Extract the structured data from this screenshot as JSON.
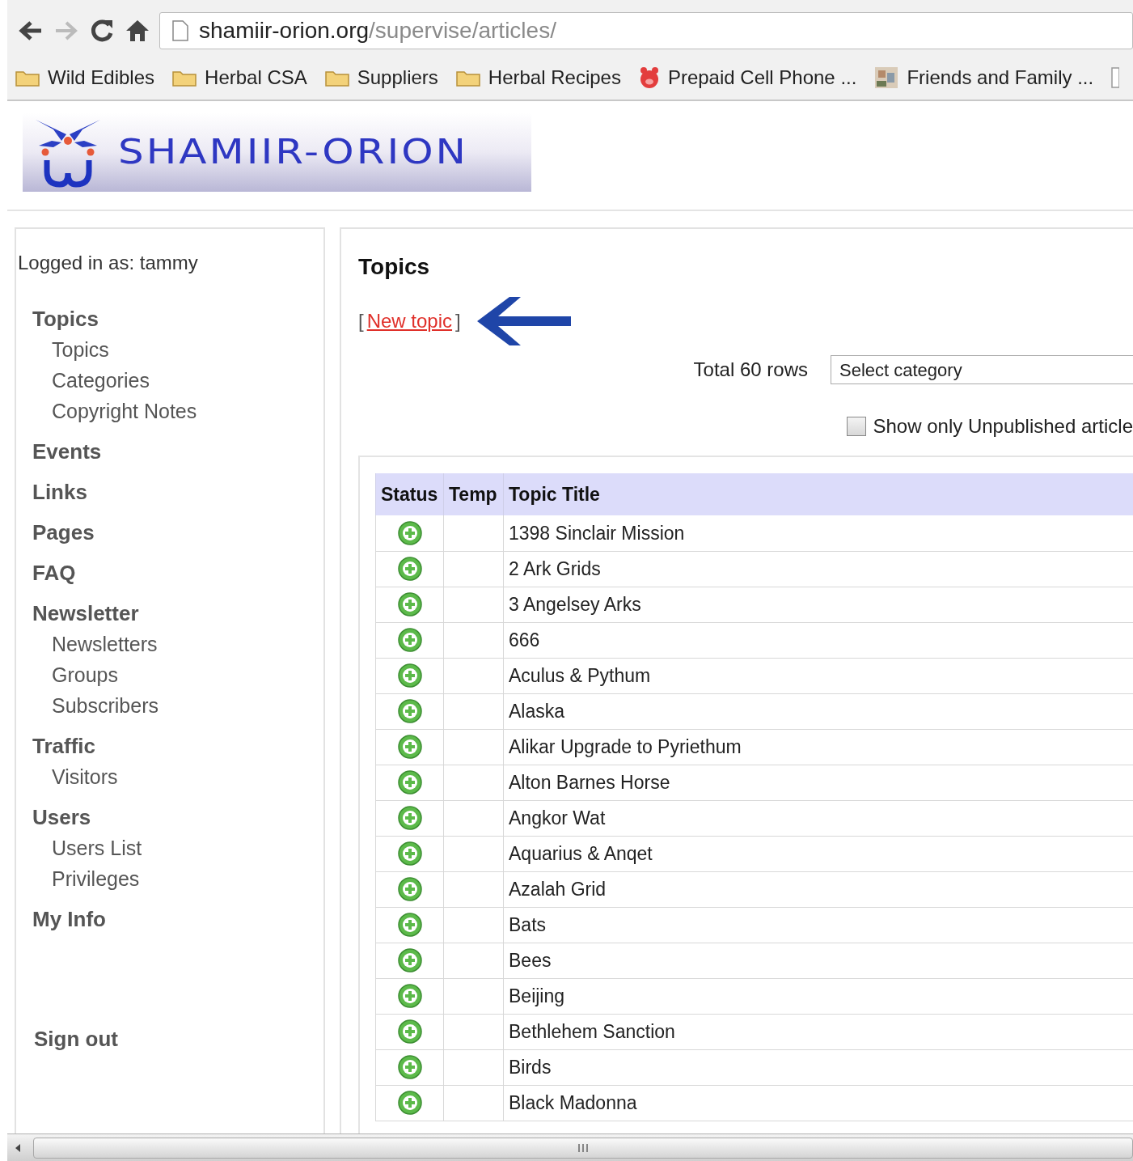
{
  "browser": {
    "address_host": "shamiir-orion.org",
    "address_path": "/supervise/articles/",
    "bookmarks": [
      {
        "kind": "folder",
        "label": "Wild Edibles"
      },
      {
        "kind": "folder",
        "label": "Herbal CSA"
      },
      {
        "kind": "folder",
        "label": "Suppliers"
      },
      {
        "kind": "folder",
        "label": "Herbal Recipes"
      },
      {
        "kind": "pig",
        "label": "Prepaid Cell Phone ..."
      },
      {
        "kind": "photo",
        "label": "Friends and Family ..."
      },
      {
        "kind": "page"
      }
    ]
  },
  "logo": {
    "text": "SHAMIIR-ORION"
  },
  "sidebar": {
    "logged_in": "Logged in as: tammy",
    "sections": [
      {
        "label": "Topics",
        "children": [
          {
            "label": "Topics"
          },
          {
            "label": "Categories"
          },
          {
            "label": "Copyright Notes"
          }
        ]
      },
      {
        "label": "Events"
      },
      {
        "label": "Links"
      },
      {
        "label": "Pages"
      },
      {
        "label": "FAQ"
      },
      {
        "label": "Newsletter",
        "children": [
          {
            "label": "Newsletters"
          },
          {
            "label": "Groups"
          },
          {
            "label": "Subscribers"
          }
        ]
      },
      {
        "label": "Traffic",
        "children": [
          {
            "label": "Visitors"
          }
        ]
      },
      {
        "label": "Users",
        "children": [
          {
            "label": "Users List"
          },
          {
            "label": "Privileges"
          }
        ]
      },
      {
        "label": "My Info"
      }
    ],
    "sign_out": "Sign out"
  },
  "main": {
    "title": "Topics",
    "bracket_open": "[",
    "new_link": "New topic",
    "bracket_close": "]",
    "total": "Total 60 rows",
    "category_select": "Select category",
    "unpublished_filter": {
      "label": "Show only Unpublished article",
      "checked": false
    },
    "table": {
      "columns": [
        "Status",
        "Temp",
        "Topic Title"
      ],
      "rows": [
        {
          "title": "1398 Sinclair Mission"
        },
        {
          "title": "2 Ark Grids"
        },
        {
          "title": "3 Angelsey Arks"
        },
        {
          "title": "666"
        },
        {
          "title": "Aculus & Pythum"
        },
        {
          "title": "Alaska"
        },
        {
          "title": "Alikar Upgrade to Pyriethum"
        },
        {
          "title": "Alton Barnes Horse"
        },
        {
          "title": "Angkor Wat"
        },
        {
          "title": "Aquarius & Anqet"
        },
        {
          "title": "Azalah Grid"
        },
        {
          "title": "Bats"
        },
        {
          "title": "Bees"
        },
        {
          "title": "Beijing"
        },
        {
          "title": "Bethlehem Sanction"
        },
        {
          "title": "Birds"
        },
        {
          "title": "Black Madonna"
        }
      ]
    }
  }
}
